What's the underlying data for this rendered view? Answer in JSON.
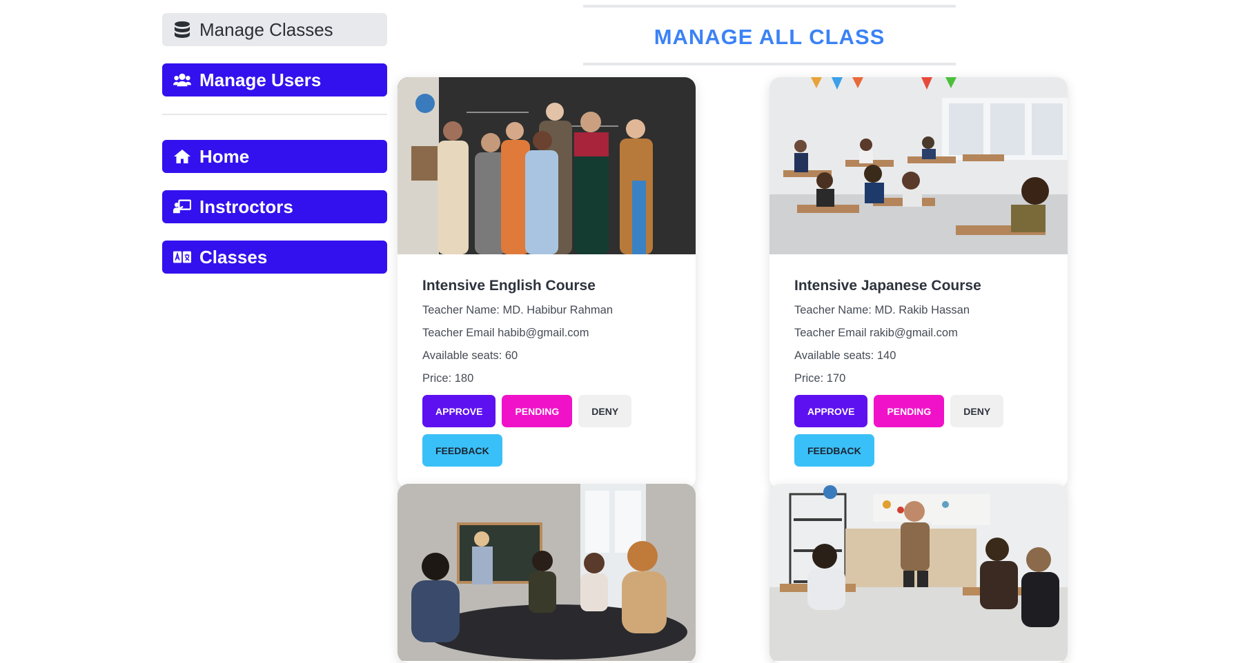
{
  "sidebar": {
    "items": [
      {
        "label": "Manage Classes",
        "icon": "database-icon",
        "active": true
      },
      {
        "label": "Manage Users",
        "icon": "users-icon",
        "active": false
      },
      {
        "label": "Home",
        "icon": "home-icon",
        "active": false
      },
      {
        "label": "Instroctors",
        "icon": "chalkboard-teacher-icon",
        "active": false
      },
      {
        "label": "Classes",
        "icon": "language-icon",
        "active": false
      }
    ]
  },
  "main": {
    "title": "MANAGE ALL CLASS",
    "cards": [
      {
        "title": "Intensive English Course",
        "teacher_name": "Teacher Name: MD. Habibur Rahman",
        "teacher_email": "Teacher Email habib@gmail.com",
        "seats": "Available seats: 60",
        "price": "Price: 180",
        "image": "students-group-photo"
      },
      {
        "title": "Intensive Japanese Course",
        "teacher_name": "Teacher Name: MD. Rakib Hassan",
        "teacher_email": "Teacher Email rakib@gmail.com",
        "seats": "Available seats: 140",
        "price": "Price: 170",
        "image": "classroom-desks-photo"
      },
      {
        "image": "students-group-study-photo"
      },
      {
        "image": "teacher-classroom-photo"
      }
    ],
    "actions": {
      "approve": "APPROVE",
      "pending": "PENDING",
      "deny": "DENY",
      "feedback": "FEEDBACK"
    }
  },
  "colors": {
    "primary": "#3311ee",
    "heading": "#3b82f6",
    "approve": "#5e11f0",
    "pending": "#f012c8",
    "feedback": "#3ac0f8"
  }
}
